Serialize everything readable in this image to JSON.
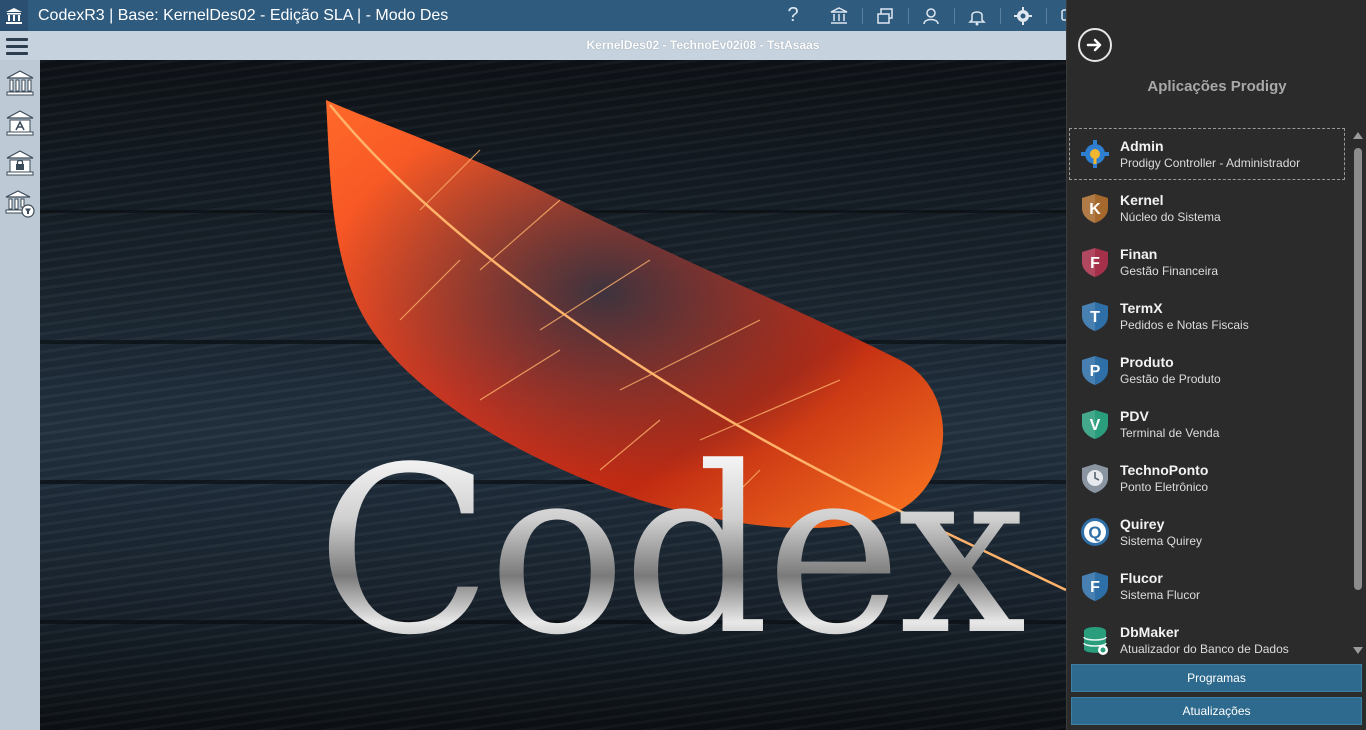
{
  "titlebar": {
    "title": "CodexR3 | Base: KernelDes02 - Edição SLA | - Modo Des",
    "tools": [
      {
        "icon": "help-icon",
        "glyph": "?"
      },
      {
        "icon": "institution-icon"
      },
      {
        "icon": "windows-icon"
      },
      {
        "icon": "user-icon"
      },
      {
        "icon": "bell-icon"
      },
      {
        "icon": "gear-icon"
      },
      {
        "icon": "chat-icon"
      }
    ]
  },
  "subbar": {
    "context": "KernelDes02 - TechnoEv02i08 - TstAsaas"
  },
  "rail": {
    "items": [
      {
        "icon": "institution-icon"
      },
      {
        "icon": "institution-doc-icon"
      },
      {
        "icon": "institution-lock-icon"
      },
      {
        "icon": "institution-filter-icon"
      }
    ]
  },
  "stage": {
    "wordmark": "Codex"
  },
  "panel": {
    "title": "Aplicações Prodigy",
    "apps": [
      {
        "name": "Admin",
        "desc": "Prodigy Controller - Administrador",
        "icon": "gear-shield-icon",
        "color": "#2f7fd1",
        "letter": "",
        "selected": true
      },
      {
        "name": "Kernel",
        "desc": "Núcleo do Sistema",
        "icon": "kernel-shield-icon",
        "color": "#a5692e",
        "letter": "K"
      },
      {
        "name": "Finan",
        "desc": "Gestão Financeira",
        "icon": "finan-shield-icon",
        "color": "#a5304a",
        "letter": "F"
      },
      {
        "name": "TermX",
        "desc": "Pedidos e Notas Fiscais",
        "icon": "termx-shield-icon",
        "color": "#2f6fa7",
        "letter": "T"
      },
      {
        "name": "Produto",
        "desc": "Gestão de Produto",
        "icon": "produto-shield-icon",
        "color": "#2f6fa7",
        "letter": "P"
      },
      {
        "name": "PDV",
        "desc": "Terminal de Venda",
        "icon": "pdv-shield-icon",
        "color": "#2a9d7d",
        "letter": "V"
      },
      {
        "name": "TechnoPonto",
        "desc": "Ponto Eletrônico",
        "icon": "clock-shield-icon",
        "color": "#8b95a2",
        "letter": ""
      },
      {
        "name": "Quirey",
        "desc": "Sistema Quirey",
        "icon": "quirey-shield-icon",
        "color": "#2f6fa7",
        "letter": "Q"
      },
      {
        "name": "Flucor",
        "desc": "Sistema Flucor",
        "icon": "flucor-shield-icon",
        "color": "#2f6fa7",
        "letter": "F"
      },
      {
        "name": "DbMaker",
        "desc": "Atualizador do Banco de Dados",
        "icon": "database-icon",
        "color": "#2a9d7d",
        "letter": ""
      }
    ],
    "buttons": {
      "programas": "Programas",
      "atualizacoes": "Atualizações"
    }
  },
  "colors": {
    "titlebar": "#2f5b7f",
    "subbar": "#c6d2dd",
    "panel": "#2b2b2b",
    "panel_button": "#2e6a8e"
  }
}
